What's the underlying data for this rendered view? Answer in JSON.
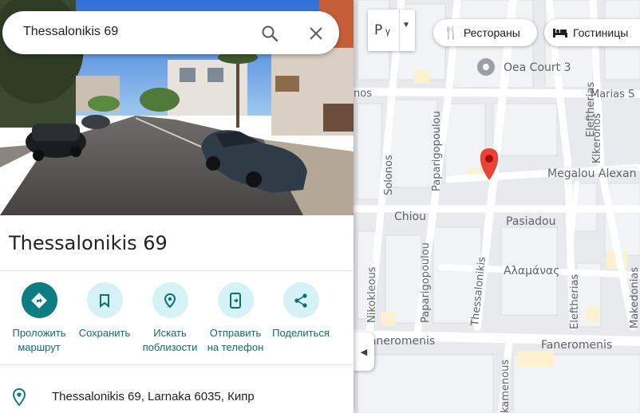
{
  "search": {
    "query": "Thessalonikis 69"
  },
  "place": {
    "title": "Thessalonikis 69",
    "address": "Thessalonikis 69, Larnaka 6035, Кипр"
  },
  "actions": [
    {
      "line1": "Проложить",
      "line2": "маршрут"
    },
    {
      "line1": "Сохранить",
      "line2": ""
    },
    {
      "line1": "Искать",
      "line2": "поблизости"
    },
    {
      "line1": "Отправить",
      "line2": "на телефон"
    },
    {
      "line1": "Поделиться",
      "line2": ""
    }
  ],
  "map": {
    "layer_label": "Р",
    "chips": {
      "restaurants": "Рестораны",
      "hotels": "Гостиницы"
    },
    "labels": {
      "oea_court": "Oea Court 3",
      "marias": "Marias S",
      "kikeronos": "Kikeronos",
      "eleftherias_top": "Eleftherias",
      "megalou": "Megalou Alexan",
      "solonos": "Solonos",
      "paparigopoulou_top": "Paparigopoulou",
      "nos": "nos",
      "chiou": "Chiou",
      "pasiadou": "Pasiadou",
      "paparigopoulou_bottom": "Paparigopoulou",
      "nikokleous": "Nikokleous",
      "thessalonikis": "Thessalonikis",
      "alamanas": "Αλαμάνας",
      "eleftherias_bottom": "Eleftherias",
      "makedonias": "Makedonias",
      "faneromenis_left": "Faneromenis",
      "faneromenis_right": "Faneromenis",
      "kamenous": "kamenous"
    }
  },
  "colors": {
    "accent": "#0b7e83",
    "pin": "#ea4335",
    "action_bg": "#d5f3f7"
  }
}
